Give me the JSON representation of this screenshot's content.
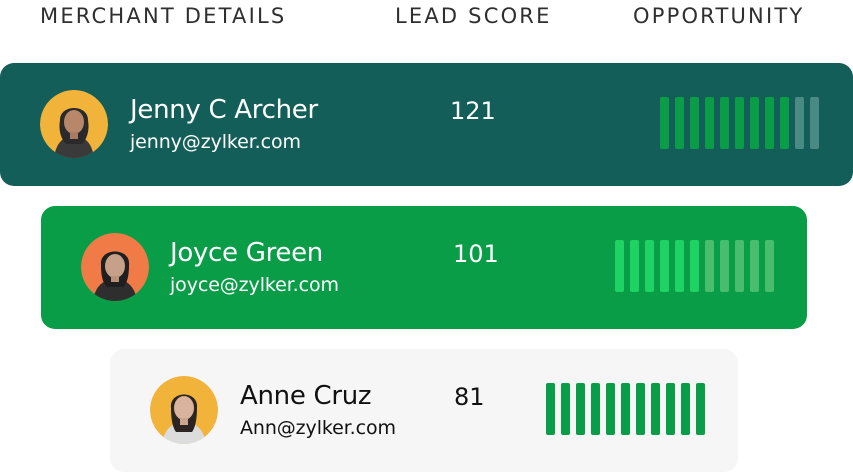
{
  "header": {
    "merchant_details": "MERCHANT DETAILS",
    "lead_score": "LEAD SCORE",
    "opportunity": "OPPORTUNITY"
  },
  "merchants": [
    {
      "name": "Jenny C Archer",
      "email": "jenny@zylker.com",
      "lead_score": "121",
      "opportunity_filled": 9,
      "opportunity_total": 11,
      "card_color": "#145e5a",
      "bar_on_color": "#0a9d47",
      "bar_off_color": "#4a8a84",
      "avatar_bg": "#f2b33a"
    },
    {
      "name": "Joyce Green",
      "email": "joyce@zylker.com",
      "lead_score": "101",
      "opportunity_filled": 6,
      "opportunity_total": 11,
      "card_color": "#0a9d47",
      "bar_on_color": "#1ed263",
      "bar_off_color": "#48bd6e",
      "avatar_bg": "#f07b46"
    },
    {
      "name": "Anne Cruz",
      "email": "Ann@zylker.com",
      "lead_score": "81",
      "opportunity_filled": 11,
      "opportunity_total": 11,
      "card_color": "#f6f6f6",
      "bar_on_color": "#0a9d47",
      "bar_off_color": "#cfe9d8",
      "avatar_bg": "#f2b33a"
    }
  ]
}
